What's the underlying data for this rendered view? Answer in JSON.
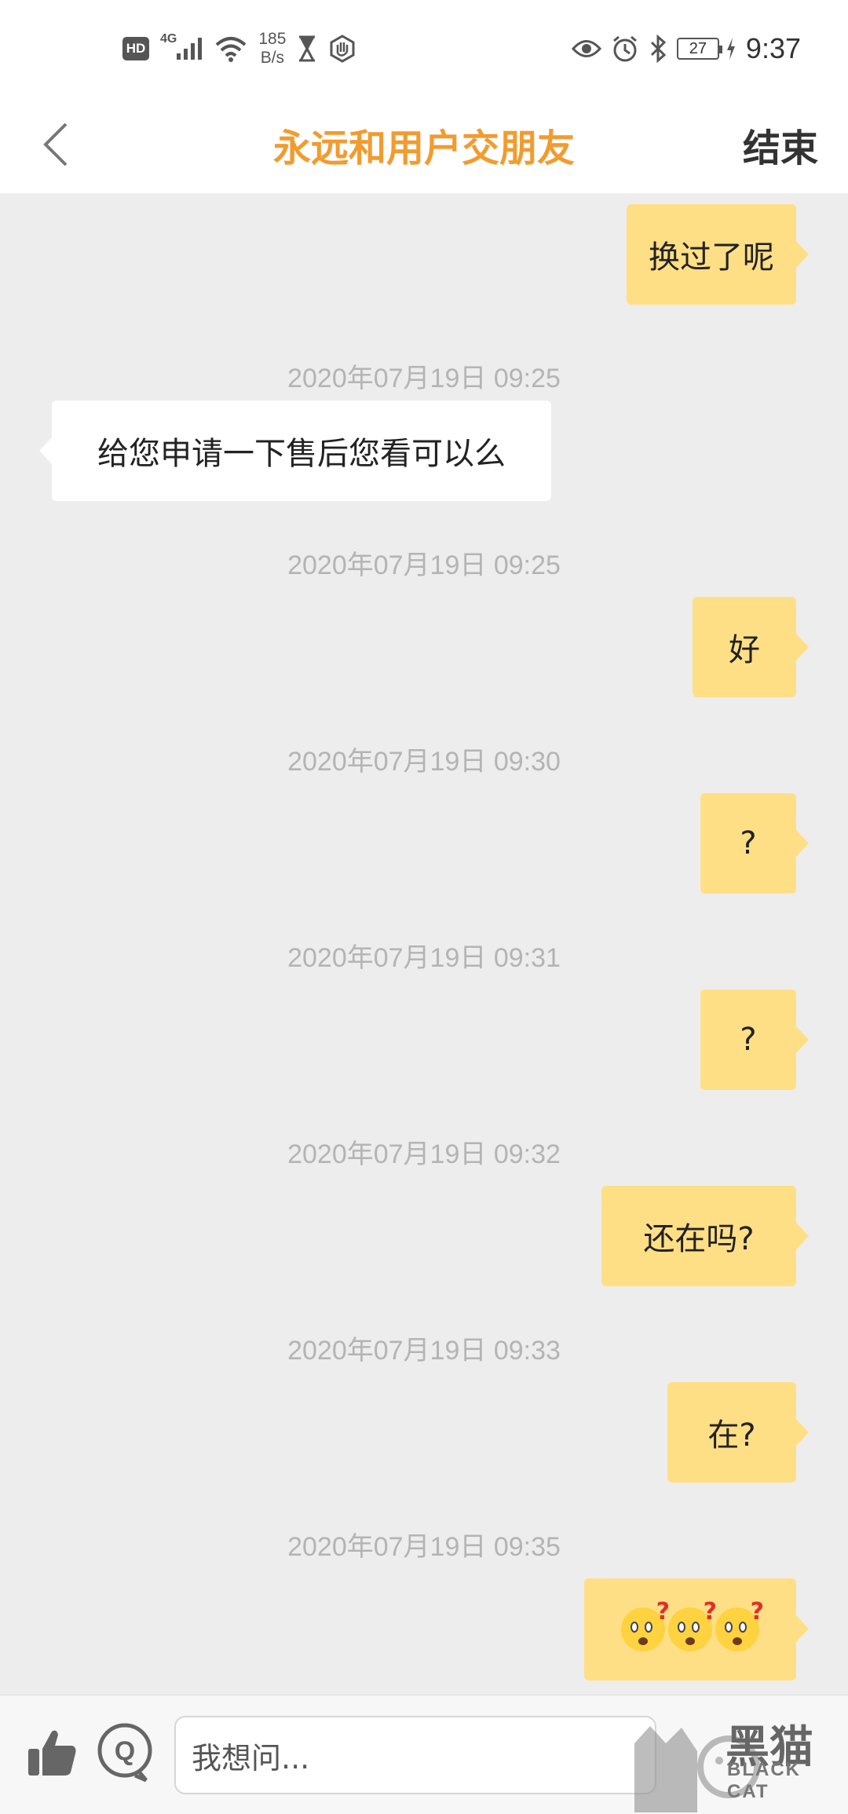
{
  "status_bar": {
    "hd": "HD",
    "network": "4G",
    "speed_value": "185",
    "speed_unit": "B/s",
    "battery": "27",
    "time": "9:37",
    "icons": [
      "signal-icon",
      "wifi-icon",
      "hourglass-icon",
      "hand-icon",
      "eye-icon",
      "alarm-icon",
      "bluetooth-icon",
      "battery-icon",
      "charging-icon"
    ]
  },
  "header": {
    "title": "永远和用户交朋友",
    "end_label": "结束",
    "title_color": "#f29b2e"
  },
  "messages": [
    {
      "timestamp": "",
      "side": "me",
      "text": "换过了呢"
    },
    {
      "timestamp": "2020年07月19日 09:25",
      "side": "them",
      "text": "给您申请一下售后您看可以么"
    },
    {
      "timestamp": "2020年07月19日 09:25",
      "side": "me",
      "text": "好"
    },
    {
      "timestamp": "2020年07月19日 09:30",
      "side": "me",
      "text": "?"
    },
    {
      "timestamp": "2020年07月19日 09:31",
      "side": "me",
      "text": "?"
    },
    {
      "timestamp": "2020年07月19日 09:32",
      "side": "me",
      "text": "还在吗?"
    },
    {
      "timestamp": "2020年07月19日 09:33",
      "side": "me",
      "text": "在?"
    },
    {
      "timestamp": "2020年07月19日 09:35",
      "side": "me",
      "text": "",
      "emoji": [
        "confused-face-emoji",
        "confused-face-emoji",
        "confused-face-emoji"
      ]
    }
  ],
  "colors": {
    "my_bubble": "#ffdf86",
    "their_bubble": "#ffffff",
    "chat_background": "#ededed",
    "timestamp": "#b4b4b4"
  },
  "input": {
    "placeholder": "我想问..."
  },
  "watermark": {
    "text_cn": "黑猫",
    "text_en": "BLACK CAT"
  }
}
